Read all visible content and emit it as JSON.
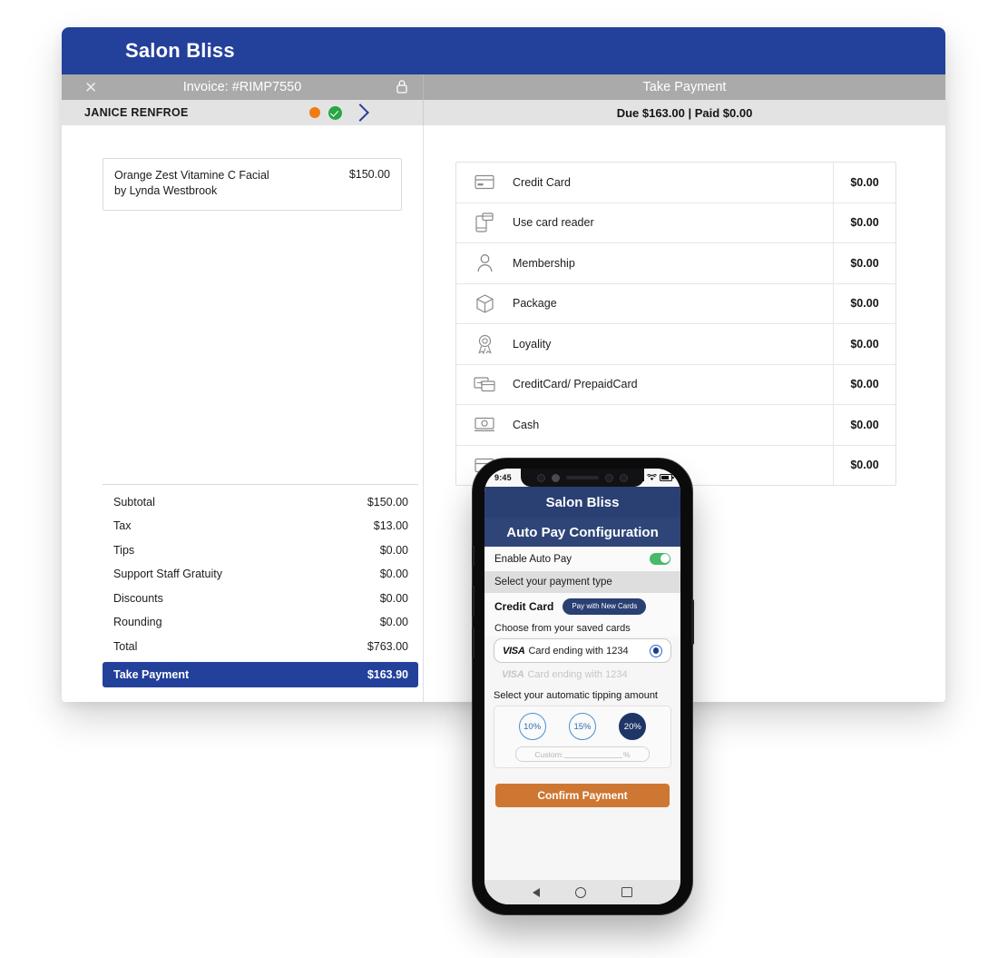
{
  "app": {
    "brand_title": "Salon Bliss",
    "close_icon": "close-icon",
    "lock_icon": "lock-icon",
    "invoice_label": "Invoice: #RIMP7550",
    "right_header_title": "Take Payment",
    "customer_name": "JANICE RENFROE",
    "due_paid_text": "Due $163.00 | Paid $0.00",
    "status_icons": [
      "orange-dot",
      "green-check",
      "chevron-right"
    ],
    "accent_blue": "#23409a",
    "header_grey": "#aaaaaa",
    "info_grey": "#e3e3e3"
  },
  "invoice": {
    "line_items": [
      {
        "name": "Orange Zest Vitamine C Facial",
        "provider": "by Lynda Westbrook",
        "price": "$150.00"
      }
    ],
    "totals": [
      {
        "label": "Subtotal",
        "value": "$150.00"
      },
      {
        "label": "Tax",
        "value": "$13.00"
      },
      {
        "label": "Tips",
        "value": "$0.00"
      },
      {
        "label": "Support Staff Gratuity",
        "value": "$0.00"
      },
      {
        "label": "Discounts",
        "value": "$0.00"
      },
      {
        "label": "Rounding",
        "value": "$0.00"
      },
      {
        "label": "Total",
        "value": "$763.00"
      }
    ],
    "take_payment": {
      "label": "Take Payment",
      "value": "$163.90"
    }
  },
  "payment_methods": [
    {
      "icon": "credit-card-icon",
      "label": "Credit Card",
      "amount": "$0.00"
    },
    {
      "icon": "card-reader-icon",
      "label": "Use card reader",
      "amount": "$0.00"
    },
    {
      "icon": "membership-icon",
      "label": "Membership",
      "amount": "$0.00"
    },
    {
      "icon": "package-icon",
      "label": "Package",
      "amount": "$0.00"
    },
    {
      "icon": "loyalty-icon",
      "label": "Loyality",
      "amount": "$0.00"
    },
    {
      "icon": "prepaid-card-icon",
      "label": "CreditCard/ PrepaidCard",
      "amount": "$0.00"
    },
    {
      "icon": "cash-icon",
      "label": "Cash",
      "amount": "$0.00"
    },
    {
      "icon": "gift-card-icon",
      "label": "",
      "amount": "$0.00"
    }
  ],
  "phone": {
    "status_bar": {
      "time": "9:45",
      "signal_icon": "signal-bars-icon",
      "wifi_icon": "wifi-icon",
      "battery_icon": "battery-icon"
    },
    "brand_title": "Salon Bliss",
    "screen_title": "Auto Pay Configuration",
    "enable_auto_pay_label": "Enable Auto Pay",
    "enable_auto_pay_on": true,
    "select_payment_type_label": "Select your payment type",
    "credit_card_label": "Credit Card",
    "pay_with_new_cards_label": "Pay with New Cards",
    "choose_saved_cards_label": "Choose from your saved cards",
    "saved_cards": [
      {
        "brand": "VISA",
        "text": "Card ending with 1234",
        "selected": true
      },
      {
        "brand": "VISA",
        "text": "Card ending with 1234",
        "selected": false
      }
    ],
    "tipping_label": "Select your automatic tipping amount",
    "tip_options": [
      {
        "label": "10%",
        "active": false
      },
      {
        "label": "15%",
        "active": false
      },
      {
        "label": "20%",
        "active": true
      }
    ],
    "custom_tip": {
      "prefix": "Custom:",
      "suffix": "%"
    },
    "confirm_button_label": "Confirm Payment",
    "nav": {
      "back": "back-triangle-icon",
      "home": "home-circle-icon",
      "recents": "recents-square-icon"
    },
    "accent_blue": "#2a3f72",
    "confirm_color": "#ce7733",
    "toggle_on_color": "#49b869"
  }
}
